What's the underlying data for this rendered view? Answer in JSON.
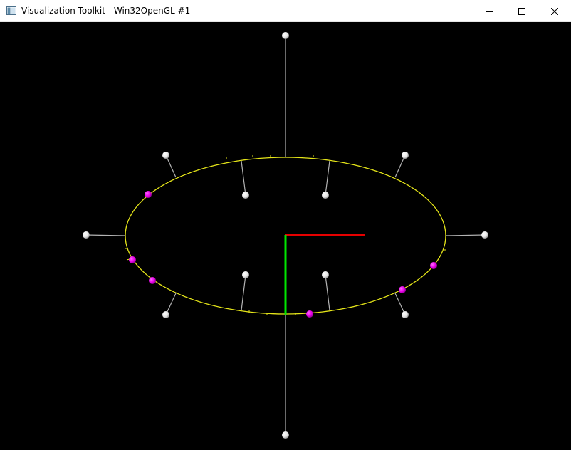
{
  "window": {
    "title": "Visualization Toolkit - Win32OpenGL #1"
  },
  "icons": {
    "app": "vtk-window-icon",
    "minimize": "minimize-icon",
    "maximize": "maximize-icon",
    "close": "close-icon"
  },
  "colors": {
    "background": "#000000",
    "ellipse": "#e6e619",
    "leader_line": "#b3b3b3",
    "handle": "#ffffff",
    "selected_handle": "#e600e6",
    "x_axis": "#e60000",
    "y_axis": "#00e600"
  }
}
